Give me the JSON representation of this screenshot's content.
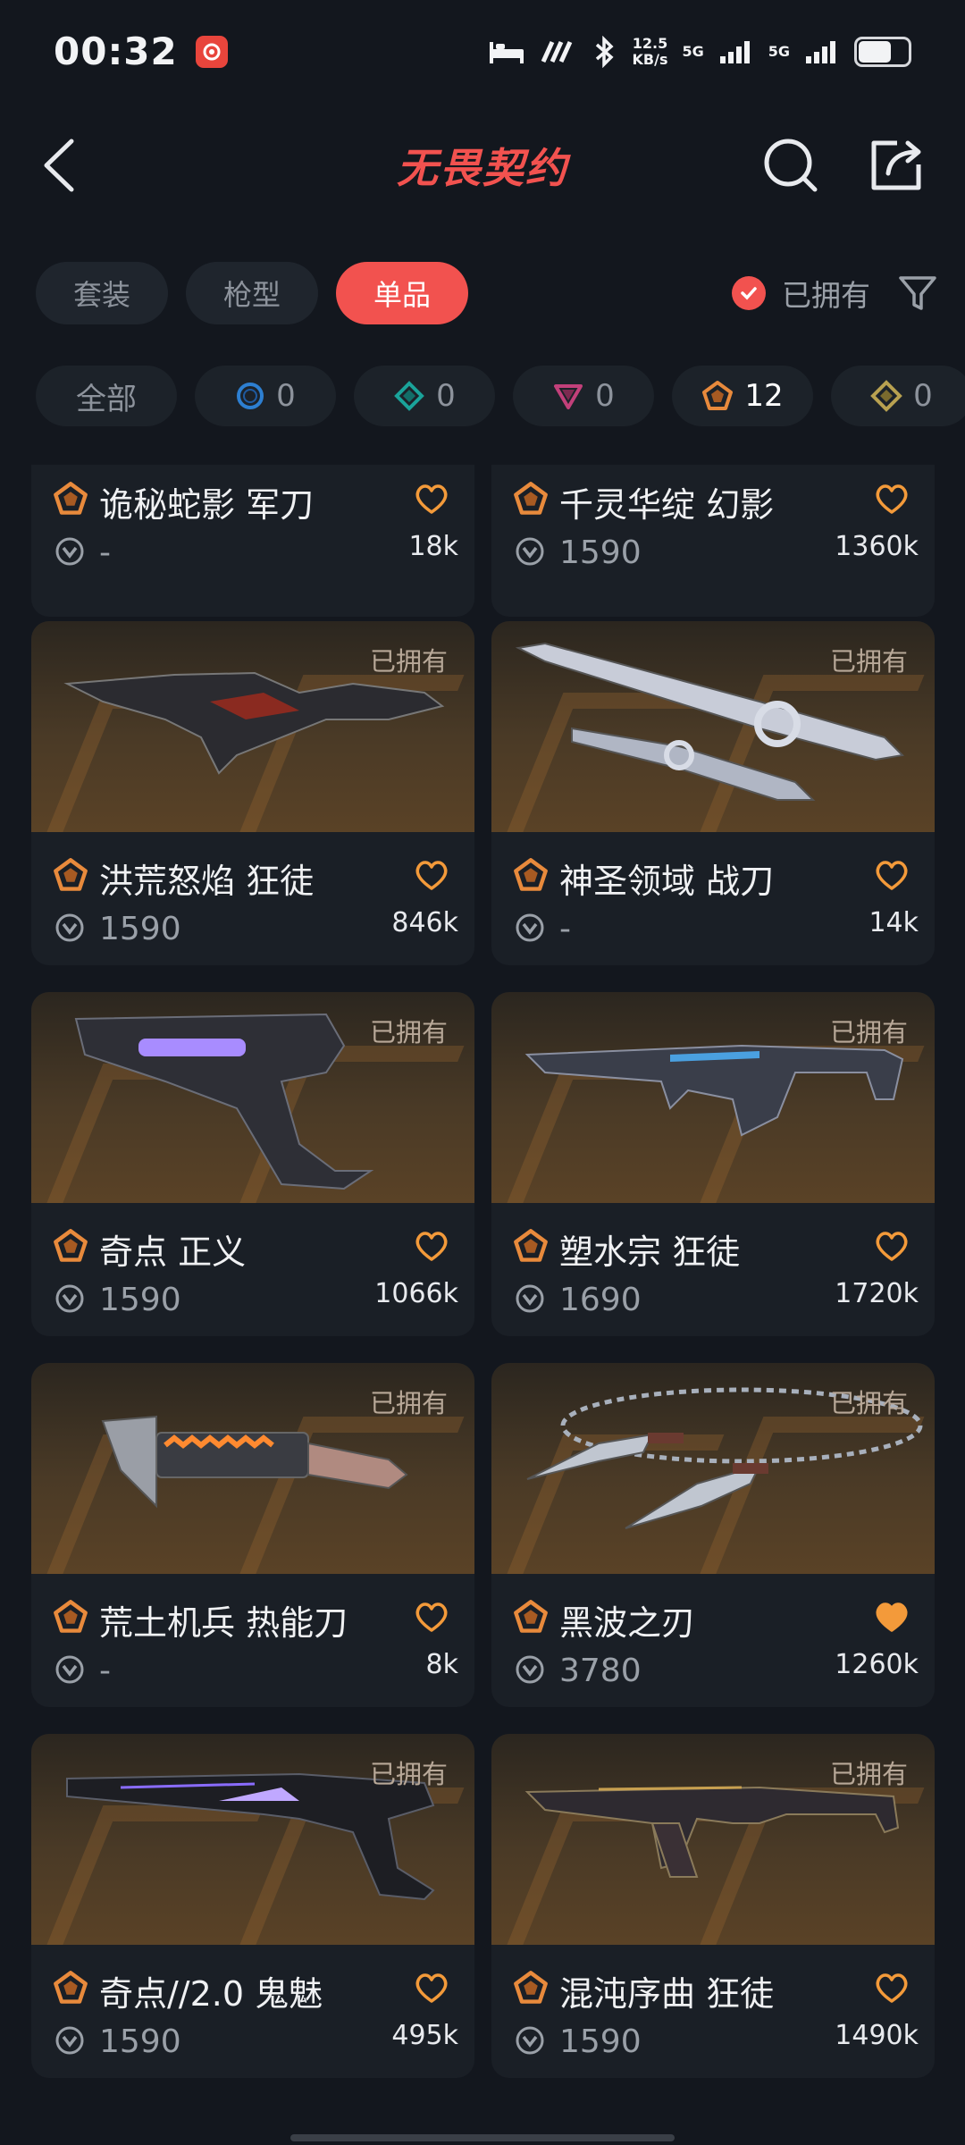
{
  "status_bar": {
    "time": "00:32",
    "net_speed_value": "12.5",
    "net_speed_unit": "KB/s",
    "signal1": "5G",
    "signal2": "5G"
  },
  "header": {
    "title": "无畏契约"
  },
  "tabs": [
    {
      "label": "套装",
      "active": false
    },
    {
      "label": "枪型",
      "active": false
    },
    {
      "label": "单品",
      "active": true
    }
  ],
  "owned_filter": {
    "label": "已拥有",
    "checked": true
  },
  "rarity_chips": [
    {
      "label": "全部",
      "icon": "none"
    },
    {
      "label": "0",
      "icon": "circle-blue"
    },
    {
      "label": "0",
      "icon": "diamond-teal"
    },
    {
      "label": "0",
      "icon": "triangle-pink"
    },
    {
      "label": "12",
      "icon": "pentagon-orange"
    },
    {
      "label": "0",
      "icon": "diamond-gold"
    }
  ],
  "items": [
    {
      "name": "诡秘蛇影 军刀",
      "price": "-",
      "likes": "18k",
      "owned": "",
      "favorited": false
    },
    {
      "name": "千灵华绽 幻影",
      "price": "1590",
      "likes": "1360k",
      "owned": "",
      "favorited": false
    },
    {
      "name": "洪荒怒焰 狂徒",
      "price": "1590",
      "likes": "846k",
      "owned": "已拥有",
      "favorited": false
    },
    {
      "name": "神圣领域 战刀",
      "price": "-",
      "likes": "14k",
      "owned": "已拥有",
      "favorited": false
    },
    {
      "name": "奇点 正义",
      "price": "1590",
      "likes": "1066k",
      "owned": "已拥有",
      "favorited": false
    },
    {
      "name": "塑水宗 狂徒",
      "price": "1690",
      "likes": "1720k",
      "owned": "已拥有",
      "favorited": false
    },
    {
      "name": "荒土机兵 热能刀",
      "price": "-",
      "likes": "8k",
      "owned": "已拥有",
      "favorited": false
    },
    {
      "name": "黑波之刃",
      "price": "3780",
      "likes": "1260k",
      "owned": "已拥有",
      "favorited": true
    },
    {
      "name": "奇点//2.0 鬼魅",
      "price": "1590",
      "likes": "495k",
      "owned": "已拥有",
      "favorited": false
    },
    {
      "name": "混沌序曲 狂徒",
      "price": "1590",
      "likes": "1490k",
      "owned": "已拥有",
      "favorited": false
    }
  ],
  "colors": {
    "accent": "#f2524f",
    "rarity_orange": "#e88a3c",
    "heart": "#f39a3a",
    "background": "#13171e"
  }
}
